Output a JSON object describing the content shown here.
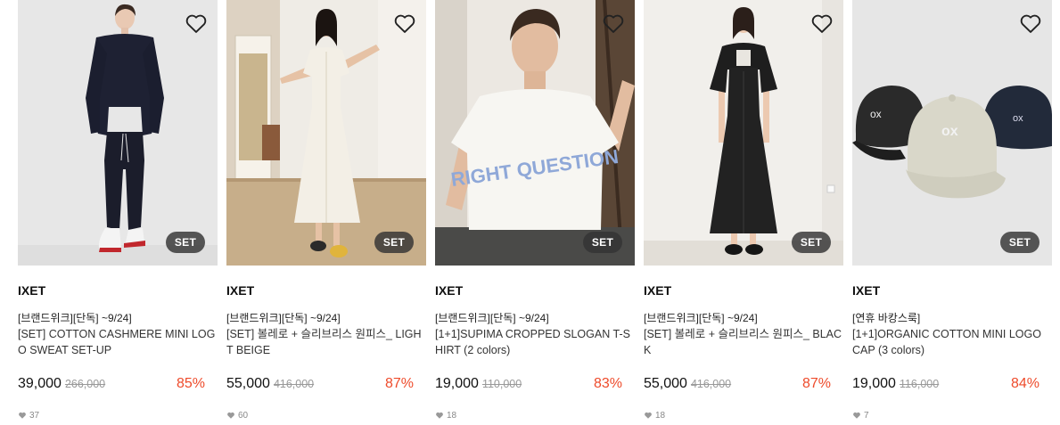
{
  "products": [
    {
      "brand": "IXET",
      "promo": "[브랜드위크][단독] ~9/24]",
      "name": "[SET] COTTON CASHMERE MINI LOGO SWEAT SET-UP",
      "price": "39,000",
      "original_price": "266,000",
      "discount": "85%",
      "likes": "37",
      "badge": "SET",
      "image": "model-navy-sweat-set"
    },
    {
      "brand": "IXET",
      "promo": "[브랜드위크][단독] ~9/24]",
      "name": "[SET] 볼레로 + 슬리브리스 원피스_ LIGHT BEIGE",
      "price": "55,000",
      "original_price": "416,000",
      "discount": "87%",
      "likes": "60",
      "badge": "SET",
      "image": "model-beige-dress"
    },
    {
      "brand": "IXET",
      "promo": "[브랜드위크][단독] ~9/24]",
      "name": "[1+1]SUPIMA CROPPED SLOGAN T-SHIRT (2 colors)",
      "price": "19,000",
      "original_price": "110,000",
      "discount": "83%",
      "likes": "18",
      "badge": "SET",
      "image": "model-slogan-tshirt"
    },
    {
      "brand": "IXET",
      "promo": "[브랜드위크][단독] ~9/24]",
      "name": "[SET] 볼레로 + 슬리브리스 원피스_ BLACK",
      "price": "55,000",
      "original_price": "416,000",
      "discount": "87%",
      "likes": "18",
      "badge": "SET",
      "image": "model-black-dress"
    },
    {
      "brand": "IXET",
      "promo": "[연휴 바캉스룩]",
      "name": "[1+1]ORGANIC COTTON MINI LOGO CAP (3 colors)",
      "price": "19,000",
      "original_price": "116,000",
      "discount": "84%",
      "likes": "7",
      "badge": "SET",
      "image": "three-caps"
    }
  ],
  "colors": {
    "discount": "#ee4b2b",
    "badge_bg": "#333333",
    "muted": "#999999"
  },
  "icons": {
    "wish": "heart-outline-icon",
    "like": "heart-filled-icon"
  }
}
